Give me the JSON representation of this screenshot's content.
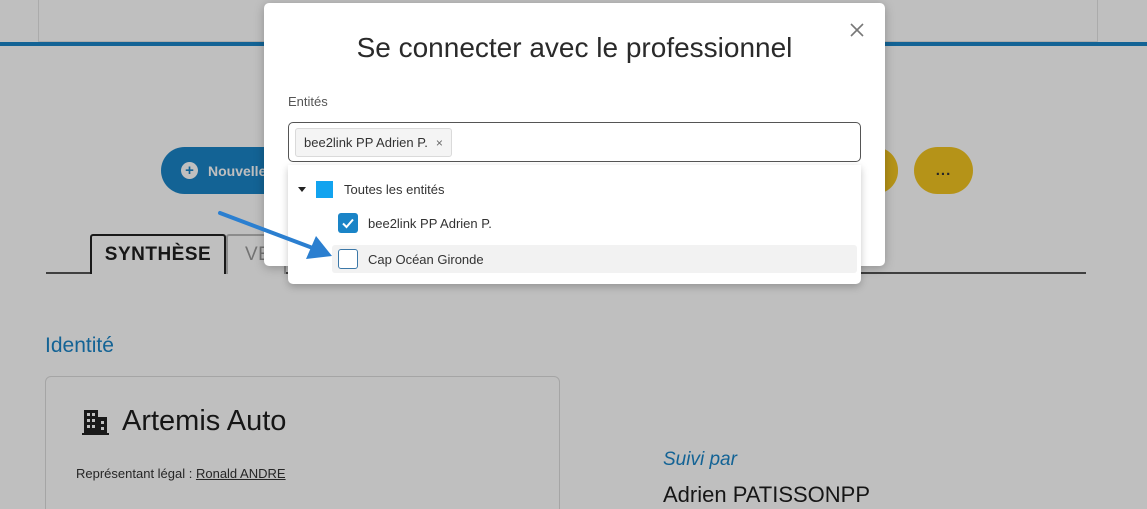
{
  "background": {
    "new_button_label": "Nouvelle",
    "more_button_label": "...",
    "tabs": [
      {
        "label": "SYNTHÈSE"
      },
      {
        "label": "VE"
      }
    ],
    "identity_section_title": "Identité",
    "company_name": "Artemis Auto",
    "legal_rep_label": "Représentant légal : ",
    "legal_rep_name": "Ronald ANDRE",
    "followed_by_label": "Suivi par",
    "followed_by_name": "Adrien PATISSONPP"
  },
  "modal": {
    "title": "Se connecter avec le professionnel",
    "field_label": "Entités",
    "selected_tags": [
      {
        "label": "bee2link PP Adrien P.",
        "remove": "×"
      }
    ]
  },
  "dropdown": {
    "all_label": "Toutes les entités",
    "items": [
      {
        "label": "bee2link PP Adrien P.",
        "checked": true
      },
      {
        "label": "Cap Océan Gironde",
        "checked": false
      }
    ]
  },
  "colors": {
    "primary_blue": "#1a84c7",
    "accent_yellow": "#f2c521",
    "partial_select_blue": "#12a3ef",
    "annotation_arrow": "#2b7fd0"
  },
  "icons": [
    "plus-icon",
    "close-icon",
    "building-icon",
    "caret-down-icon",
    "checkmark-icon",
    "annotation-arrow"
  ]
}
